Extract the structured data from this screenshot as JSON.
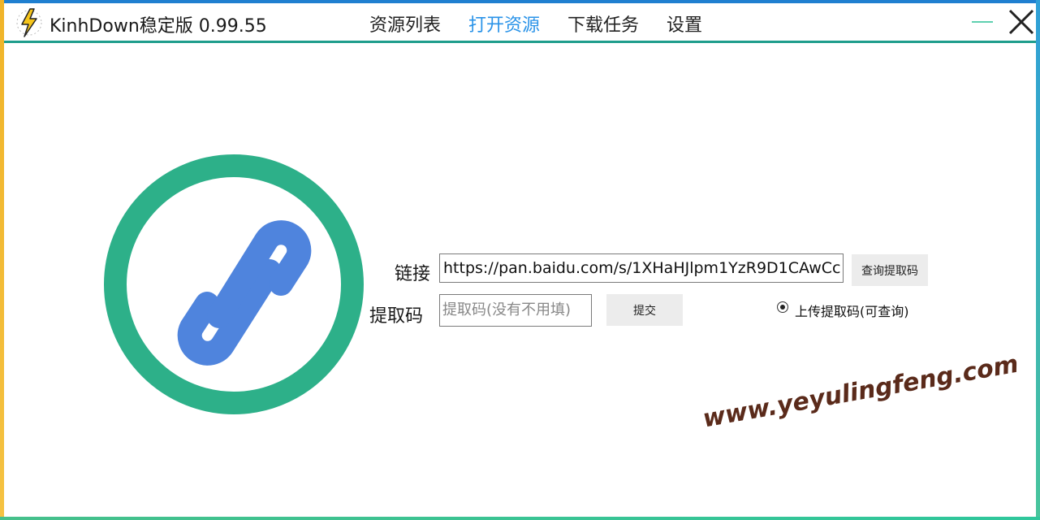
{
  "titlebar": {
    "app_title": "KinhDown稳定版 0.99.55",
    "nav": [
      "资源列表",
      "打开资源",
      "下载任务",
      "设置"
    ],
    "active_nav_index": 1
  },
  "form": {
    "link_label": "链接",
    "link_value": "https://pan.baidu.com/s/1XHaHJlpm1YzR9D1CAwCc",
    "query_button": "查询提取码",
    "code_label": "提取码",
    "code_placeholder": "提取码(没有不用填)",
    "submit_button": "提交",
    "upload_code_radio": "上传提取码(可查询)",
    "upload_code_checked": true
  },
  "watermark": "www.yeyulingfeng.com",
  "colors": {
    "accent": "#2a93e8",
    "ring": "#2db089",
    "link_icon": "#4f84dd"
  }
}
